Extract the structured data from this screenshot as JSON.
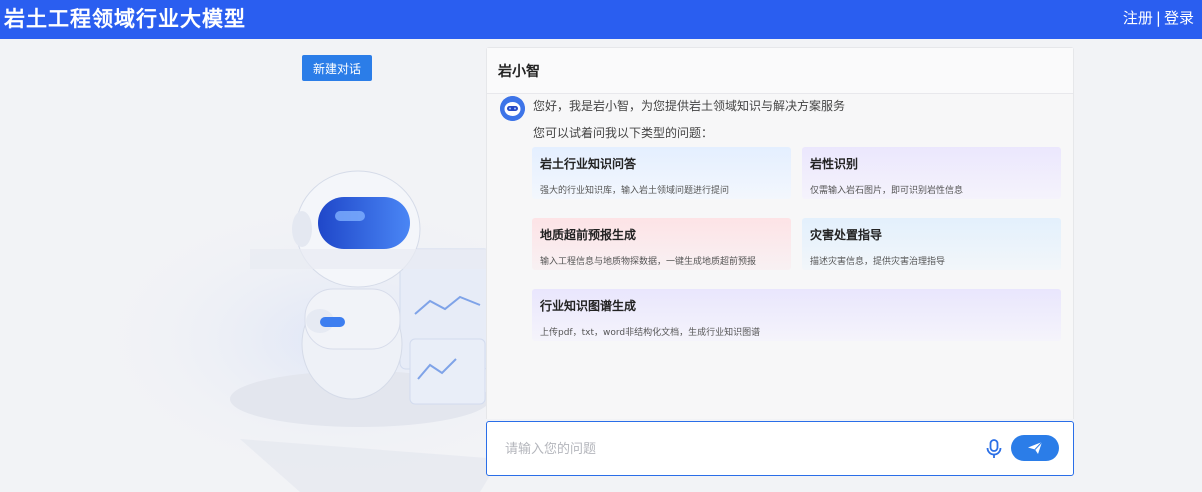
{
  "header": {
    "app_title": "岩土工程领域行业大模型",
    "register_label": "注册",
    "separator": "|",
    "login_label": "登录"
  },
  "sidebar": {
    "new_chat_label": "新建对话"
  },
  "chat": {
    "assistant_name": "岩小智",
    "greeting": "您好，我是岩小智，为您提供岩土领域知识与解决方案服务",
    "hint": "您可以试着问我以下类型的问题：",
    "cards": [
      {
        "title": "岩土行业知识问答",
        "desc": "强大的行业知识库，输入岩土领域问题进行提问"
      },
      {
        "title": "岩性识别",
        "desc": "仅需输入岩石图片，即可识别岩性信息"
      },
      {
        "title": "地质超前预报生成",
        "desc": "输入工程信息与地质物探数据，一键生成地质超前预报"
      },
      {
        "title": "灾害处置指导",
        "desc": "描述灾害信息，提供灾害治理指导"
      },
      {
        "title": "行业知识图谱生成",
        "desc": "上传pdf，txt，word非结构化文档，生成行业知识图谱"
      }
    ]
  },
  "input": {
    "placeholder": "请输入您的问题",
    "value": ""
  },
  "icons": {
    "mic": "microphone-icon",
    "send": "send-icon"
  },
  "colors": {
    "brand": "#2a5ef0",
    "accent": "#2b7de8"
  }
}
